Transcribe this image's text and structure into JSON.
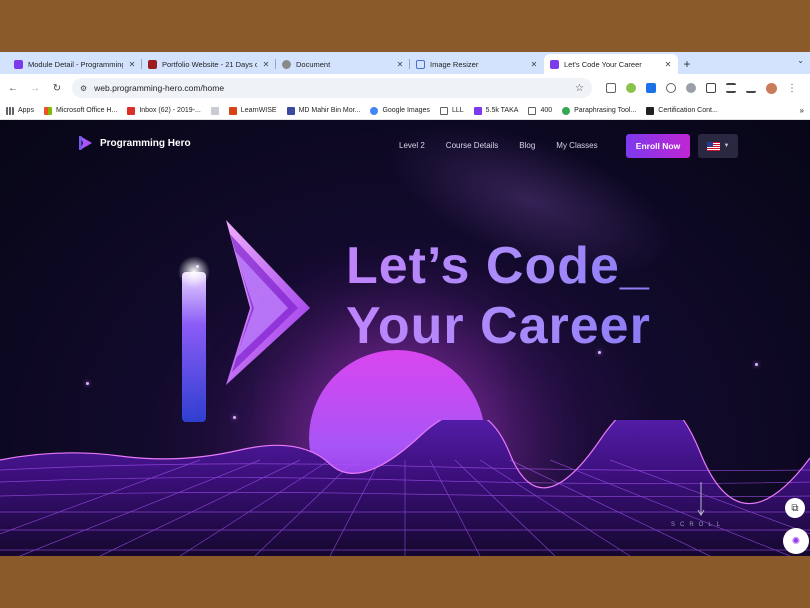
{
  "tabs": [
    {
      "title": "Module Detail - Programming",
      "favicon_color": "#7c3aed",
      "active": false
    },
    {
      "title": "Portfolio Website - 21 Days o",
      "favicon_color": "#9b1c1c",
      "active": false
    },
    {
      "title": "Document",
      "favicon_color": "#8a8a8a",
      "active": false
    },
    {
      "title": "Image Resizer",
      "favicon_color": "#4a6fd8",
      "active": false
    },
    {
      "title": "Let's Code Your Career",
      "favicon_color": "#7c3aed",
      "active": true
    }
  ],
  "toolbar": {
    "url": "web.programming-hero.com/home"
  },
  "bookmarks": [
    {
      "label": "Apps",
      "color": "#5f6368"
    },
    {
      "label": "Microsoft Office H...",
      "color": "#e8552b"
    },
    {
      "label": "Inbox (62) - 2019-...",
      "color": "#d93025"
    },
    {
      "label": "",
      "color": "#9aa0a6"
    },
    {
      "label": "LearnWISE",
      "color": "#d84315"
    },
    {
      "label": "MD Mahir Bin Mor...",
      "color": "#3b4a9e"
    },
    {
      "label": "Google Images",
      "color": "#4285f4"
    },
    {
      "label": "LLL",
      "color": "#5f6368"
    },
    {
      "label": "5.5k TAKA",
      "color": "#7c3aed"
    },
    {
      "label": "400",
      "color": "#5f6368"
    },
    {
      "label": "Paraphrasing Tool...",
      "color": "#34a853"
    },
    {
      "label": "Certification Cont...",
      "color": "#202124"
    }
  ],
  "site": {
    "brand": "Programming Hero",
    "nav": [
      "Level 2",
      "Course Details",
      "Blog",
      "My Classes"
    ],
    "enroll_label": "Enroll Now",
    "headline_line1": "Let’s Code_",
    "headline_line2": "Your Career",
    "scroll_label": "SCROLL"
  },
  "colors": {
    "accent": "#7c3aed",
    "accent2": "#c026d3",
    "headline": "#b18cf7"
  }
}
